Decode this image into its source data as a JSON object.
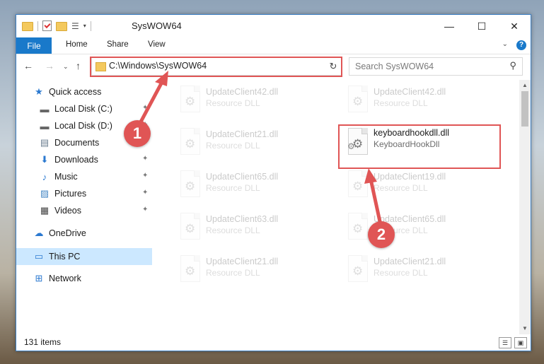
{
  "window": {
    "title": "SysWOW64"
  },
  "ribbon": {
    "tabs": [
      "File",
      "Home",
      "Share",
      "View"
    ]
  },
  "address": {
    "path": "C:\\Windows\\SysWOW64"
  },
  "search": {
    "placeholder": "Search SysWOW64"
  },
  "sidebar": {
    "items": [
      {
        "label": "Quick access",
        "icon": "star-icon",
        "pinned": false
      },
      {
        "label": "Local Disk (C:)",
        "icon": "drive-icon",
        "pinned": true
      },
      {
        "label": "Local Disk (D:)",
        "icon": "drive-icon",
        "pinned": true
      },
      {
        "label": "Documents",
        "icon": "documents-icon",
        "pinned": true
      },
      {
        "label": "Downloads",
        "icon": "download-icon",
        "pinned": true
      },
      {
        "label": "Music",
        "icon": "music-icon",
        "pinned": true
      },
      {
        "label": "Pictures",
        "icon": "pictures-icon",
        "pinned": true
      },
      {
        "label": "Videos",
        "icon": "videos-icon",
        "pinned": true
      },
      {
        "label": "OneDrive",
        "icon": "onedrive-icon",
        "pinned": false
      },
      {
        "label": "This PC",
        "icon": "computer-icon",
        "pinned": false,
        "selected": true
      },
      {
        "label": "Network",
        "icon": "network-icon",
        "pinned": false
      }
    ]
  },
  "files": [
    {
      "name": "UpdateClient42.dll",
      "type": "Resource DLL",
      "faded": true
    },
    {
      "name": "UpdateClient42.dll",
      "type": "Resource DLL",
      "faded": true
    },
    {
      "name": "UpdateClient21.dll",
      "type": "Resource DLL",
      "faded": true
    },
    {
      "name": "keyboardhookdll.dll",
      "type": "KeyboardHookDll",
      "faded": false,
      "highlighted": true
    },
    {
      "name": "UpdateClient65.dll",
      "type": "Resource DLL",
      "faded": true
    },
    {
      "name": "UpdateClient19.dll",
      "type": "Resource DLL",
      "faded": true
    },
    {
      "name": "UpdateClient63.dll",
      "type": "Resource DLL",
      "faded": true
    },
    {
      "name": "UpdateClient65.dll",
      "type": "Resource DLL",
      "faded": true
    },
    {
      "name": "UpdateClient21.dll",
      "type": "Resource DLL",
      "faded": true
    },
    {
      "name": "UpdateClient21.dll",
      "type": "Resource DLL",
      "faded": true
    }
  ],
  "status": {
    "item_count": "131 items"
  },
  "annotations": {
    "step1": "1",
    "step2": "2",
    "color": "#e05555"
  }
}
